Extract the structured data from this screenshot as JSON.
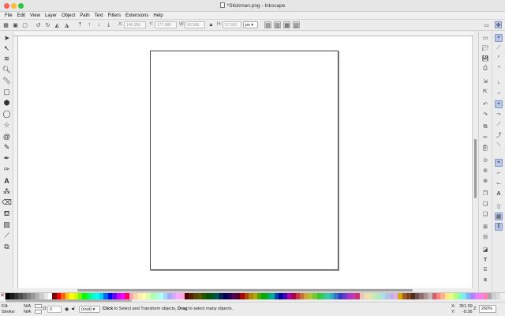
{
  "window": {
    "title": "*Stickman.png - Inkscape",
    "traffic_lights": {
      "close": "#ff5f57",
      "minimize": "#febc2e",
      "zoom": "#28c840"
    }
  },
  "menu": [
    "File",
    "Edit",
    "View",
    "Layer",
    "Object",
    "Path",
    "Text",
    "Filters",
    "Extensions",
    "Help"
  ],
  "command_bar": {
    "x_label": "X:",
    "x_value": "146.356",
    "y_label": "Y:",
    "y_value": "177.980",
    "w_label": "W:",
    "w_value": "50.566",
    "h_label": "H:",
    "h_value": "57.552",
    "unit": "px"
  },
  "status": {
    "fill_label": "Fill:",
    "fill_value": "N/A",
    "stroke_label": "Stroke:",
    "stroke_value": "N/A",
    "opacity_label": "O:",
    "opacity_value": "0",
    "layer": "(root)",
    "message_click": "Click",
    "message_mid": " to Select and Transform objects, ",
    "message_drag": "Drag",
    "message_end": " to select many objects.",
    "x_coord_label": "X:",
    "x_coord": "351.59",
    "y_coord_label": "Y:",
    "y_coord": "-0.36",
    "zoom_label": "Z:",
    "zoom": "260%"
  },
  "icons": {
    "toolbox": [
      "selector-icon",
      "node-icon",
      "tweak-icon",
      "zoom-icon",
      "measure-icon",
      "rect-icon",
      "3dbox-icon",
      "ellipse-icon",
      "star-icon",
      "spiral-icon",
      "pencil-icon",
      "pen-icon",
      "calligraphy-icon",
      "text-icon",
      "spray-icon",
      "eraser-icon",
      "bucket-icon",
      "gradient-icon",
      "dropper-icon",
      "connector-icon"
    ]
  },
  "palette_colors": [
    "#000000",
    "#1a1a1a",
    "#333333",
    "#4d4d4d",
    "#666666",
    "#808080",
    "#999999",
    "#b3b3b3",
    "#cccccc",
    "#e6e6e6",
    "#ffffff",
    "#800000",
    "#ff0000",
    "#ff6600",
    "#ffcc00",
    "#ffff00",
    "#ccff00",
    "#66ff00",
    "#00ff00",
    "#00ff66",
    "#00ffcc",
    "#00ffff",
    "#00ccff",
    "#0066ff",
    "#0000ff",
    "#6600ff",
    "#cc00ff",
    "#ff00ff",
    "#ff0066",
    "#ffaaaa",
    "#ffd5aa",
    "#ffeeaa",
    "#ffffaa",
    "#d5ffaa",
    "#aaffaa",
    "#aaffd5",
    "#aaffff",
    "#aad5ff",
    "#aaaaff",
    "#d5aaff",
    "#ffaaff",
    "#ffaad5",
    "#550000",
    "#552200",
    "#554400",
    "#555500",
    "#225500",
    "#005500",
    "#005522",
    "#005555",
    "#002255",
    "#000055",
    "#220055",
    "#550055",
    "#550022",
    "#aa0000",
    "#aa4400",
    "#aa8800",
    "#aaaa00",
    "#44aa00",
    "#00aa00",
    "#00aa44",
    "#00aaaa",
    "#0044aa",
    "#0000aa",
    "#4400aa",
    "#aa00aa",
    "#aa0044",
    "#c83737",
    "#c87137",
    "#c8ab37",
    "#abc837",
    "#71c837",
    "#37c837",
    "#37c871",
    "#37c8ab",
    "#37abc8",
    "#3771c8",
    "#3737c8",
    "#7137c8",
    "#ab37c8",
    "#c837ab",
    "#c83771",
    "#e9c6af",
    "#e9ddaf",
    "#dde9af",
    "#c6e9af",
    "#afe9c6",
    "#afdde9",
    "#afc6e9",
    "#c6afe9",
    "#e9afdd",
    "#d4aa00",
    "#a05a2c",
    "#784421",
    "#502d16",
    "#6c5353",
    "#916f6f",
    "#ac9393",
    "#c8b7b7",
    "#d35f5f",
    "#ff8080",
    "#ffb380",
    "#ffe680",
    "#e5ff80",
    "#b3ff80",
    "#80ffb3",
    "#80e5ff",
    "#80b3ff",
    "#b380ff",
    "#e580ff",
    "#ff80e5",
    "#ff80b3",
    "#a8a8a8",
    "#cfcfcf",
    "#dcdcdc",
    "#efefef"
  ]
}
